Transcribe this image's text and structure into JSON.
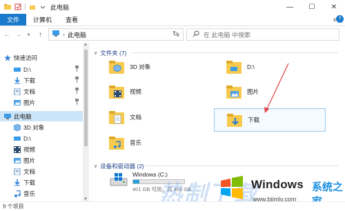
{
  "window": {
    "title": "此电脑",
    "controls": {
      "minimize": "—",
      "maximize": "☐",
      "close": "✕"
    }
  },
  "ribbon": {
    "tabs": [
      "文件",
      "计算机",
      "查看"
    ],
    "expand": "∨",
    "help": "?"
  },
  "address": {
    "back": "←",
    "forward": "→",
    "recent": "∨",
    "up": "↑",
    "separator": "›",
    "path": "此电脑",
    "dropdown": "∨",
    "refresh": "↻",
    "search_placeholder": "在 此电脑 中搜索"
  },
  "sidebar": {
    "quick_access": "快速访问",
    "items": [
      {
        "label": "D:\\",
        "pinned": true
      },
      {
        "label": "下载",
        "pinned": true
      },
      {
        "label": "文档",
        "pinned": true
      },
      {
        "label": "图片",
        "pinned": true
      }
    ],
    "this_pc": "此电脑",
    "pc_items": [
      "3D 对象",
      "D:\\",
      "视频",
      "图片",
      "文档",
      "下载",
      "音乐"
    ],
    "pin_glyph": "📌"
  },
  "content": {
    "folders_header": "文件夹 (7)",
    "folders": [
      "3D 对象",
      "D:\\",
      "视频",
      "图片",
      "文档",
      "下载",
      "音乐"
    ],
    "devices_header": "设备和驱动器 (2)",
    "drive": {
      "name": "Windows (C:)",
      "free_text": "401 GB 可用，共 455 GB",
      "used_fraction": 0.12
    }
  },
  "status": {
    "item_count": "9 个项目"
  },
  "watermark": {
    "brand": "Windows",
    "brand_suffix": "系统之家",
    "url": "www.bjjmlv.com",
    "overlay": "热制下载"
  },
  "colors": {
    "accent": "#1979ca",
    "selection": "#cce4f7",
    "folder": "#f7ca4e",
    "arrow": "#e04040"
  }
}
